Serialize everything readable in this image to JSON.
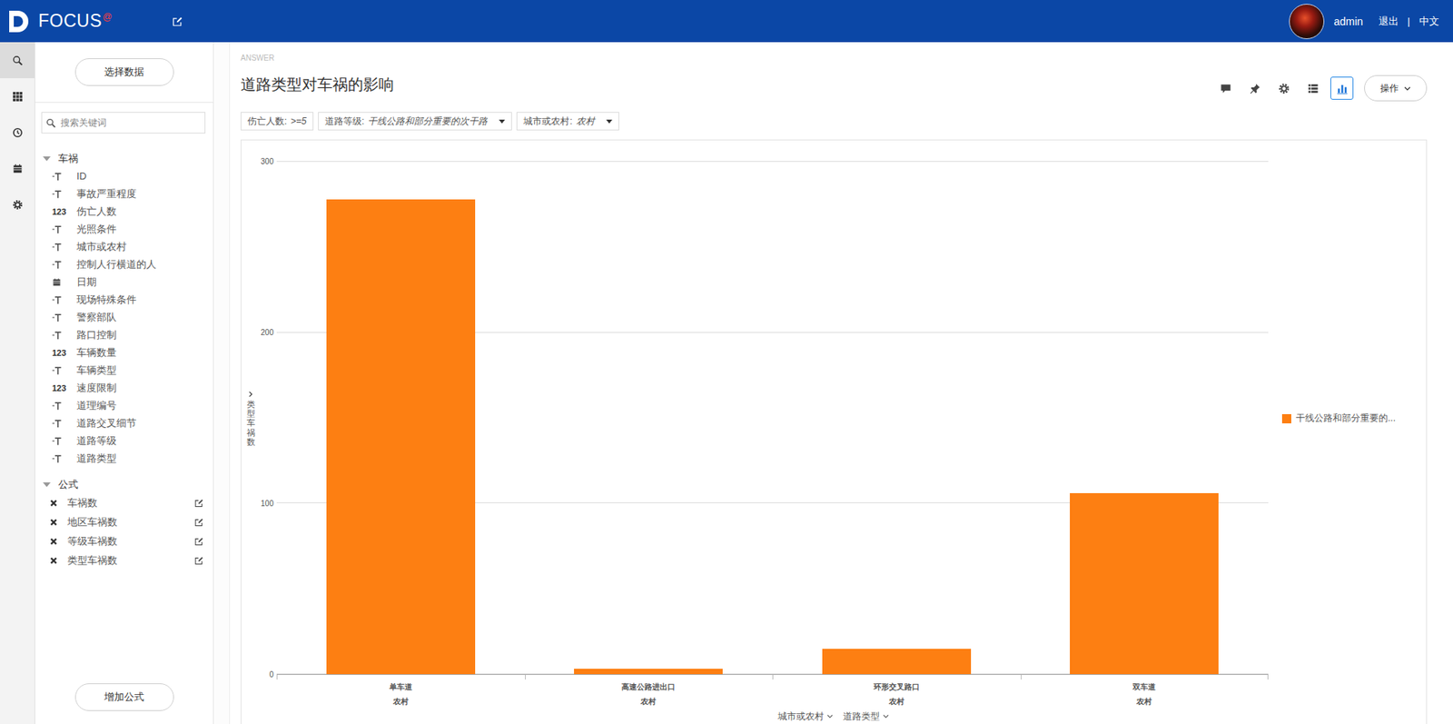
{
  "topbar": {
    "logo": "FOCUS",
    "logo_mark": "@",
    "user": "admin",
    "logout": "退出",
    "separator": "|",
    "language": "中文"
  },
  "rail": [
    {
      "kind": "search",
      "selected": true
    },
    {
      "kind": "apps",
      "selected": false
    },
    {
      "kind": "history",
      "selected": false
    },
    {
      "kind": "calendar",
      "selected": false
    },
    {
      "kind": "settings",
      "selected": false
    }
  ],
  "panel": {
    "select_button": "选择数据",
    "search_placeholder": "搜索关键词",
    "groups": [
      {
        "label": "车祸",
        "expanded": true,
        "items": [
          {
            "label": "ID",
            "kind": "text"
          },
          {
            "label": "事故严重程度",
            "kind": "text"
          },
          {
            "label": "伤亡人数",
            "kind": "number",
            "type_label": "123"
          },
          {
            "label": "光照条件",
            "kind": "text"
          },
          {
            "label": "城市或农村",
            "kind": "text"
          },
          {
            "label": "控制人行横道的人",
            "kind": "text"
          },
          {
            "label": "日期",
            "kind": "date"
          },
          {
            "label": "现场特殊条件",
            "kind": "text"
          },
          {
            "label": "警察部队",
            "kind": "text"
          },
          {
            "label": "路口控制",
            "kind": "text"
          },
          {
            "label": "车辆数量",
            "kind": "number",
            "type_label": "123"
          },
          {
            "label": "车辆类型",
            "kind": "text"
          },
          {
            "label": "速度限制",
            "kind": "number",
            "type_label": "123"
          },
          {
            "label": "道理编号",
            "kind": "text"
          },
          {
            "label": "道路交叉细节",
            "kind": "text"
          },
          {
            "label": "道路等级",
            "kind": "text"
          },
          {
            "label": "道路类型",
            "kind": "text"
          }
        ]
      },
      {
        "label": "公式",
        "expanded": true,
        "items": [
          {
            "label": "车祸数",
            "kind": "formula"
          },
          {
            "label": "地区车祸数",
            "kind": "formula"
          },
          {
            "label": "等级车祸数",
            "kind": "formula"
          },
          {
            "label": "类型车祸数",
            "kind": "formula"
          }
        ]
      }
    ],
    "add_button": "增加公式"
  },
  "answer": {
    "label": "ANSWER",
    "title": "道路类型对车祸的影响",
    "filters": [
      {
        "label": "伤亡人数:",
        "value": ">=5",
        "dropdown": false
      },
      {
        "label": "道路等级:",
        "value": "干线公路和部分重要的次干路",
        "dropdown": true
      },
      {
        "label": "城市或农村:",
        "value": "农村",
        "dropdown": true
      }
    ],
    "toolbar": [
      {
        "kind": "comment",
        "selected": false
      },
      {
        "kind": "pin",
        "selected": false
      },
      {
        "kind": "settings",
        "selected": false
      },
      {
        "kind": "table",
        "selected": false
      },
      {
        "kind": "chart",
        "selected": true
      }
    ],
    "actions_button": "操作"
  },
  "chart": {
    "y_title": "类型车祸数",
    "y_ticks": [
      "300",
      "200",
      "100",
      "0"
    ],
    "categories": [
      {
        "label": "单车道",
        "sub": "农村"
      },
      {
        "label": "高速公路进出口",
        "sub": "农村"
      },
      {
        "label": "环形交叉路口",
        "sub": "农村"
      },
      {
        "label": "双车道",
        "sub": "农村"
      }
    ],
    "series": [
      {
        "name": "干线公路和部分重要的...",
        "color": "#fd7f12",
        "values": [
          278,
          3,
          15,
          106
        ]
      }
    ],
    "x_titles": [
      "城市或农村",
      "道路类型"
    ]
  }
}
